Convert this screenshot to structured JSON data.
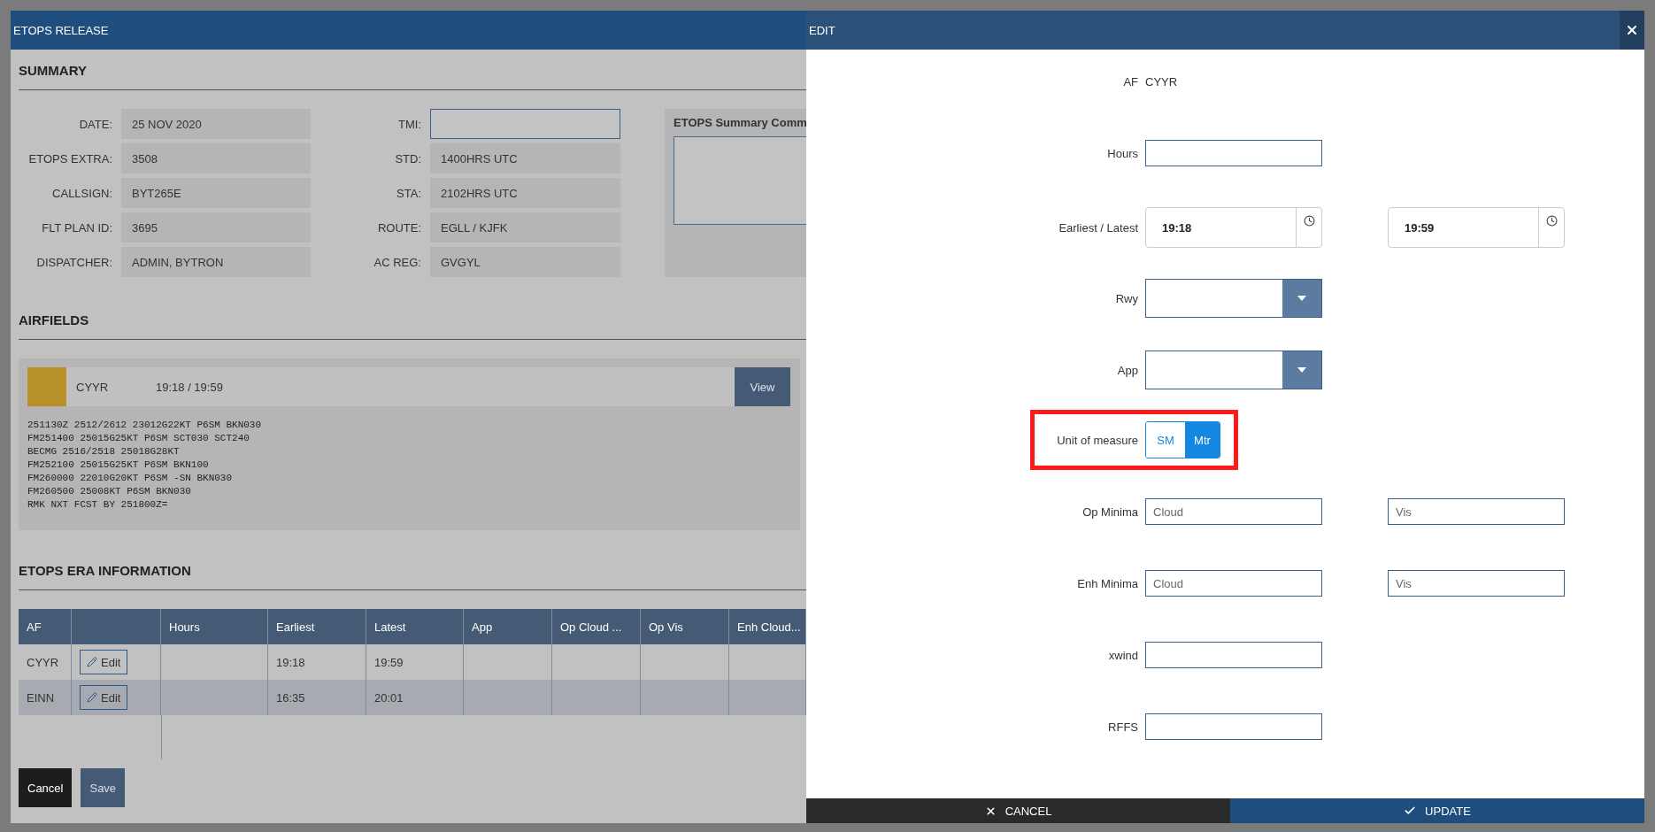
{
  "left_window": {
    "title": "ETOPS RELEASE",
    "summary": {
      "heading": "SUMMARY",
      "fields_left": [
        {
          "label": "DATE:",
          "value": "25 NOV 2020"
        },
        {
          "label": "ETOPS EXTRA:",
          "value": "3508"
        },
        {
          "label": "CALLSIGN:",
          "value": "BYT265E"
        },
        {
          "label": "FLT PLAN ID:",
          "value": "3695"
        },
        {
          "label": "DISPATCHER:",
          "value": "ADMIN, BYTRON"
        }
      ],
      "fields_right": [
        {
          "label": "TMI:",
          "kind": "input"
        },
        {
          "label": "STD:",
          "kind": "readonly",
          "value": "1400HRS UTC"
        },
        {
          "label": "STA:",
          "kind": "readonly",
          "value": "2102HRS UTC"
        },
        {
          "label": "ROUTE:",
          "kind": "readonly",
          "value": "EGLL / KJFK"
        },
        {
          "label": "AC REG:",
          "kind": "readonly",
          "value": "GVGYL"
        }
      ],
      "comments": {
        "title": "ETOPS Summary Comm"
      }
    },
    "airfields": {
      "heading": "AIRFIELDS",
      "items": [
        {
          "code": "CYYR",
          "window": "19:18 / 19:59",
          "color": "#b8902a",
          "button": "View",
          "forecast_lines": [
            "251130Z 2512/2612 23012G22KT P6SM BKN030",
            "FM251400 25015G25KT P6SM SCT030 SCT240",
            "BECMG 2516/2518 25018G28KT",
            "FM252100 25015G25KT P6SM BKN100",
            "FM260000 22010G20KT P6SM -SN BKN030",
            "FM260500 25008KT P6SM BKN030",
            "RMK NXT FCST BY 251800Z="
          ]
        }
      ]
    },
    "era": {
      "heading": "ETOPS ERA INFORMATION",
      "columns": [
        {
          "kind": "text",
          "label": "AF"
        },
        {
          "kind": "action"
        },
        {
          "kind": "text",
          "label": "Hours"
        },
        {
          "kind": "text",
          "label": "Earliest"
        },
        {
          "kind": "text",
          "label": "Latest"
        },
        {
          "kind": "text",
          "label": "App"
        },
        {
          "kind": "text",
          "label": "Op Cloud ..."
        },
        {
          "kind": "text",
          "label": "Op Vis"
        },
        {
          "kind": "text",
          "label": "Enh Cloud..."
        }
      ],
      "rows": [
        {
          "af": "CYYR",
          "edit": "Edit",
          "earliest": "19:18",
          "latest": "19:59"
        },
        {
          "af": "EINN",
          "edit": "Edit",
          "earliest": "16:35",
          "latest": "20:01"
        }
      ]
    },
    "buttons": [
      {
        "label": "Cancel",
        "kind": "dark"
      },
      {
        "label": "Save",
        "kind": "primary"
      }
    ]
  },
  "edit_panel": {
    "title": "EDIT",
    "fields": [
      {
        "kind": "static",
        "label": "AF",
        "value": "CYYR"
      },
      {
        "kind": "text",
        "label": "Hours"
      },
      {
        "kind": "time",
        "label": "Earliest / Latest",
        "values": [
          "19:18",
          "19:59"
        ]
      },
      {
        "kind": "select",
        "label": "Rwy"
      },
      {
        "kind": "select",
        "label": "App"
      },
      {
        "kind": "toggle",
        "label": "Unit of measure",
        "highlighted": true,
        "options": [
          {
            "label": "SM",
            "selected": false
          },
          {
            "label": "Mtr",
            "selected": true
          }
        ]
      },
      {
        "kind": "pair",
        "label": "Op Minima",
        "placeholders": [
          "Cloud",
          "Vis"
        ]
      },
      {
        "kind": "pair",
        "label": "Enh Minima",
        "placeholders": [
          "Cloud",
          "Vis"
        ]
      },
      {
        "kind": "text",
        "label": "xwind"
      },
      {
        "kind": "text",
        "label": "RFFS"
      }
    ],
    "footer": [
      {
        "kind": "cancel",
        "label": "CANCEL"
      },
      {
        "kind": "confirm",
        "label": "UPDATE"
      }
    ]
  }
}
